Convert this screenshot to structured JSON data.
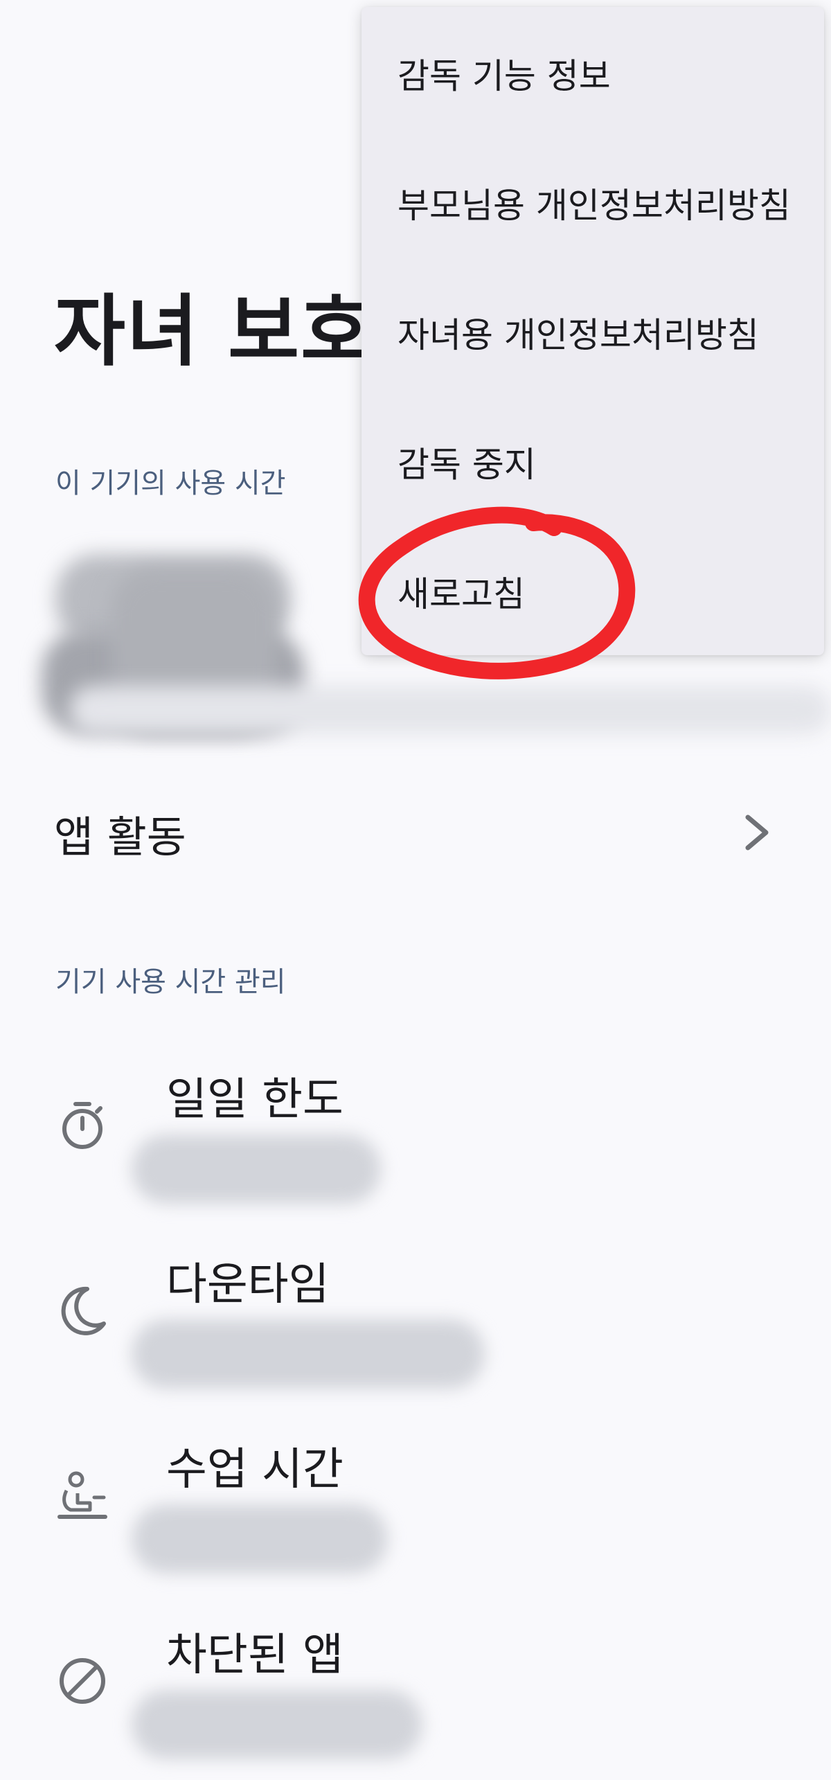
{
  "header": {
    "title": "자녀 보호"
  },
  "usage_section": {
    "header": "이 기기의 사용 시간"
  },
  "app_activity": {
    "label": "앱 활동",
    "icon": "chevron-right-icon"
  },
  "management_section": {
    "header": "기기 사용 시간 관리",
    "items": [
      {
        "title": "일일 한도",
        "icon": "timer-icon"
      },
      {
        "title": "다운타임",
        "icon": "moon-icon"
      },
      {
        "title": "수업 시간",
        "icon": "student-desk-icon"
      },
      {
        "title": "차단된 앱",
        "icon": "block-icon"
      }
    ]
  },
  "overflow_menu": {
    "items": [
      {
        "label": "감독 기능 정보"
      },
      {
        "label": "부모님용 개인정보처리방침"
      },
      {
        "label": "자녀용 개인정보처리방침"
      },
      {
        "label": "감독 중지"
      },
      {
        "label": "새로고침"
      }
    ]
  },
  "colors": {
    "background": "#f9f9fc",
    "section_header": "#4b5f7e",
    "menu_background": "#edecf2",
    "annotation": "#f0262a",
    "icon": "#6f7176"
  }
}
